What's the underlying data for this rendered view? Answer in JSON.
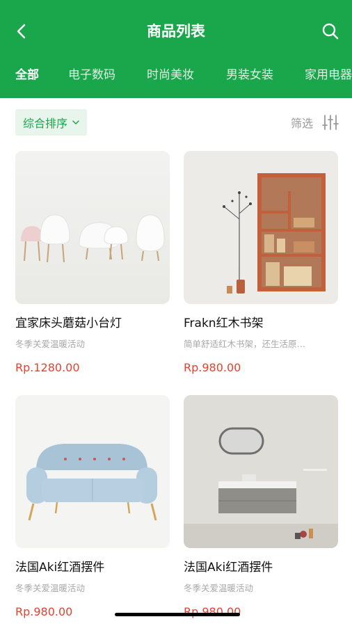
{
  "header": {
    "title": "商品列表"
  },
  "tabs": [
    {
      "label": "全部"
    },
    {
      "label": "电子数码"
    },
    {
      "label": "时尚美妆"
    },
    {
      "label": "男装女装"
    },
    {
      "label": "家用电器"
    }
  ],
  "filters": {
    "sort_label": "综合排序",
    "filter_label": "筛选"
  },
  "products": [
    {
      "name": "宜家床头蘑菇小台灯",
      "desc": "冬季关爱温暖活动",
      "price": "Rp.1280.00"
    },
    {
      "name": "Frakn红木书架",
      "desc": "简单舒适红木书架，还生活原…",
      "price": "Rp.980.00"
    },
    {
      "name": "法国Aki红酒摆件",
      "desc": "冬季关爱温暖活动",
      "price": "Rp.980.00"
    },
    {
      "name": "法国Aki红酒摆件",
      "desc": "冬季关爱温暖活动",
      "price": "Rp.980.00"
    }
  ],
  "colors": {
    "brand": "#1aa64b",
    "price": "#e8402f"
  },
  "icons": {
    "back": "back-arrow-icon",
    "search": "search-icon",
    "chevron": "chevron-down-icon",
    "filter": "filter-sliders-icon"
  }
}
